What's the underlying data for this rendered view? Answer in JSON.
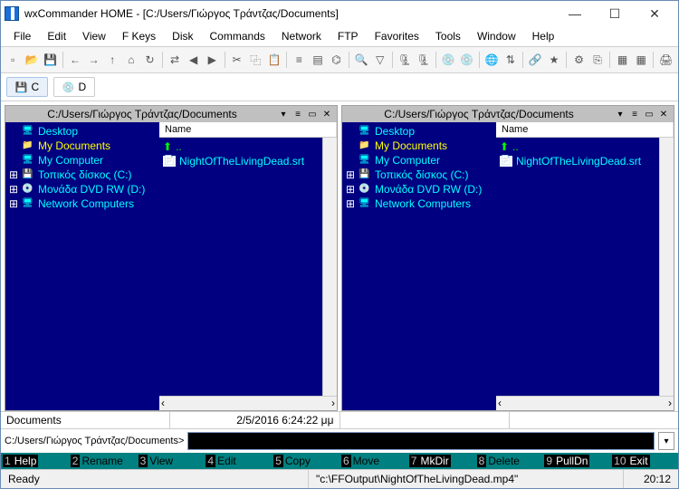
{
  "window": {
    "title": "wxCommander HOME - [C:/Users/Γιώργος Τράντζας/Documents]"
  },
  "menu": [
    "File",
    "Edit",
    "View",
    "F Keys",
    "Disk",
    "Commands",
    "Network",
    "FTP",
    "Favorites",
    "Tools",
    "Window",
    "Help"
  ],
  "drives": [
    {
      "label": "C",
      "active": true,
      "icon": "💾"
    },
    {
      "label": "D",
      "active": false,
      "icon": "💿"
    }
  ],
  "panelLeft": {
    "path": "C:/Users/Γιώργος Τράντζας/Documents",
    "tree": [
      {
        "exp": "",
        "icon": "🖥",
        "label": "Desktop",
        "sel": false
      },
      {
        "exp": "",
        "icon": "📁",
        "label": "My Documents",
        "sel": true
      },
      {
        "exp": "",
        "icon": "🖥",
        "label": "My Computer",
        "sel": false
      },
      {
        "exp": "⊞",
        "icon": "💾",
        "label": "Τοπικός δίσκος (C:)",
        "sel": false
      },
      {
        "exp": "⊞",
        "icon": "💿",
        "label": "Μονάδα DVD RW (D:)",
        "sel": false
      },
      {
        "exp": "⊞",
        "icon": "🖥",
        "label": "Network Computers",
        "sel": false
      }
    ],
    "listHeader": "Name",
    "upLabel": "..",
    "files": [
      {
        "icon": "📄",
        "name": "NightOfTheLivingDead.srt"
      }
    ]
  },
  "panelRight": {
    "path": "C:/Users/Γιώργος Τράντζας/Documents",
    "tree": [
      {
        "exp": "",
        "icon": "🖥",
        "label": "Desktop",
        "sel": false
      },
      {
        "exp": "",
        "icon": "📁",
        "label": "My Documents",
        "sel": true
      },
      {
        "exp": "",
        "icon": "🖥",
        "label": "My Computer",
        "sel": false
      },
      {
        "exp": "⊞",
        "icon": "💾",
        "label": "Τοπικός δίσκος (C:)",
        "sel": false
      },
      {
        "exp": "⊞",
        "icon": "💿",
        "label": "Μονάδα DVD RW (D:)",
        "sel": false
      },
      {
        "exp": "⊞",
        "icon": "🖥",
        "label": "Network Computers",
        "sel": false
      }
    ],
    "listHeader": "Name",
    "upLabel": "..",
    "files": [
      {
        "icon": "📄",
        "name": "NightOfTheLivingDead.srt"
      }
    ]
  },
  "info": {
    "left": "Documents",
    "right": "2/5/2016 6:24:22 μμ"
  },
  "cmd": {
    "prompt": "C:/Users/Γιώργος Τράντζας/Documents>",
    "value": ""
  },
  "fkeys": [
    {
      "n": "1",
      "l": "Help",
      "hl": true
    },
    {
      "n": "2",
      "l": "Rename",
      "hl": false
    },
    {
      "n": "3",
      "l": "View",
      "hl": false
    },
    {
      "n": "4",
      "l": "Edit",
      "hl": false
    },
    {
      "n": "5",
      "l": "Copy",
      "hl": false
    },
    {
      "n": "6",
      "l": "Move",
      "hl": false
    },
    {
      "n": "7",
      "l": "MkDir",
      "hl": true
    },
    {
      "n": "8",
      "l": "Delete",
      "hl": false
    },
    {
      "n": "9",
      "l": "PullDn",
      "hl": true
    },
    {
      "n": "10",
      "l": "Exit",
      "hl": true
    }
  ],
  "status": {
    "left": "Ready",
    "mid": "\"c:\\FFOutput\\NightOfTheLivingDead.mp4\"",
    "right": "20:12"
  },
  "toolbarIcons": [
    "file-new",
    "file-open",
    "save",
    "sep",
    "back",
    "fwd",
    "up",
    "home",
    "reload",
    "sep",
    "swap",
    "left",
    "right",
    "sep",
    "cut",
    "copy",
    "paste",
    "sep",
    "view-list",
    "view-detail",
    "tree",
    "sep",
    "find",
    "filter",
    "sep",
    "zip",
    "unzip",
    "sep",
    "disk",
    "disk2",
    "sep",
    "net",
    "ftp",
    "sep",
    "link",
    "fav",
    "sep",
    "props",
    "copyto",
    "sep",
    "grid",
    "grid2",
    "sep",
    "print"
  ]
}
